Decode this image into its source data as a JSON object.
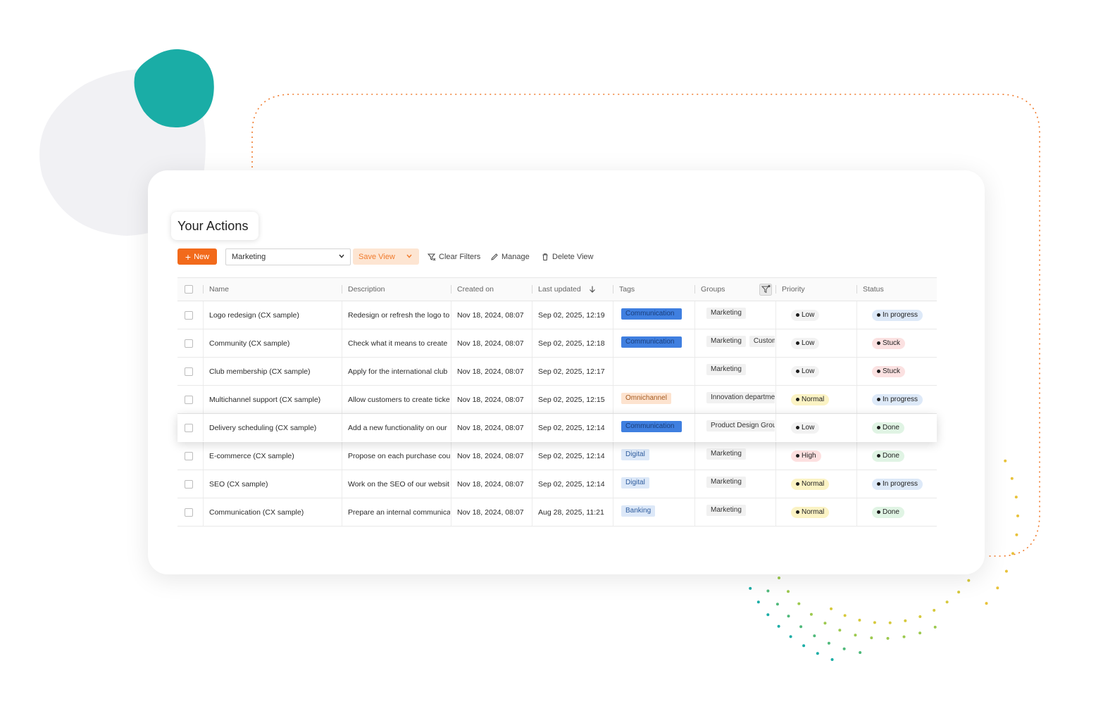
{
  "page": {
    "title": "Your Actions"
  },
  "toolbar": {
    "new_label": "New",
    "view_select": "Marketing",
    "save_view_label": "Save View",
    "clear_filters_label": "Clear Filters",
    "manage_label": "Manage",
    "delete_view_label": "Delete View"
  },
  "table": {
    "headers": {
      "name": "Name",
      "description": "Description",
      "created": "Created on",
      "updated": "Last updated",
      "tags": "Tags",
      "groups": "Groups",
      "priority": "Priority",
      "status": "Status"
    },
    "rows": [
      {
        "name": "Logo redesign (CX sample)",
        "description": "Redesign or refresh the logo to",
        "created": "Nov 18, 2024, 08:07",
        "updated": "Sep 02, 2025, 12:19",
        "tag": "Communication",
        "tag_style": "comm",
        "groups": [
          "Marketing"
        ],
        "priority": "Low",
        "status": "In progress"
      },
      {
        "name": "Community (CX sample)",
        "description": "Check what it means to create",
        "created": "Nov 18, 2024, 08:07",
        "updated": "Sep 02, 2025, 12:18",
        "tag": "Communication",
        "tag_style": "comm",
        "groups": [
          "Marketing",
          "Custom"
        ],
        "priority": "Low",
        "status": "Stuck"
      },
      {
        "name": "Club membership (CX sample)",
        "description": "Apply for the international club",
        "created": "Nov 18, 2024, 08:07",
        "updated": "Sep 02, 2025, 12:17",
        "tag": "",
        "tag_style": "none",
        "groups": [
          "Marketing"
        ],
        "priority": "Low",
        "status": "Stuck"
      },
      {
        "name": "Multichannel support (CX sample)",
        "description": "Allow customers to create ticke",
        "created": "Nov 18, 2024, 08:07",
        "updated": "Sep 02, 2025, 12:15",
        "tag": "Omnichannel",
        "tag_style": "omni",
        "groups": [
          "Innovation departme"
        ],
        "priority": "Normal",
        "status": "In progress"
      },
      {
        "name": "Delivery scheduling (CX sample)",
        "description": "Add a new functionality on our",
        "created": "Nov 18, 2024, 08:07",
        "updated": "Sep 02, 2025, 12:14",
        "tag": "Communication",
        "tag_style": "comm",
        "groups": [
          "Product Design Grou"
        ],
        "priority": "Low",
        "status": "Done"
      },
      {
        "name": "E-commerce (CX sample)",
        "description": "Propose on each purchase cou",
        "created": "Nov 18, 2024, 08:07",
        "updated": "Sep 02, 2025, 12:14",
        "tag": "Digital",
        "tag_style": "light",
        "groups": [
          "Marketing"
        ],
        "priority": "High",
        "status": "Done"
      },
      {
        "name": "SEO (CX sample)",
        "description": "Work on the SEO of our websit",
        "created": "Nov 18, 2024, 08:07",
        "updated": "Sep 02, 2025, 12:14",
        "tag": "Digital",
        "tag_style": "light",
        "groups": [
          "Marketing"
        ],
        "priority": "Normal",
        "status": "In progress"
      },
      {
        "name": "Communication (CX sample)",
        "description": "Prepare an internal communica",
        "created": "Nov 18, 2024, 08:07",
        "updated": "Aug 28, 2025, 11:21",
        "tag": "Banking",
        "tag_style": "light",
        "groups": [
          "Marketing"
        ],
        "priority": "Normal",
        "status": "Done"
      }
    ]
  },
  "colors": {
    "accent": "#f26a1b",
    "tag_communication": "#3f7fe0",
    "tag_light": "#dce8f8",
    "tag_omnichannel": "#fde3cf",
    "priority_low": "#f2f2f2",
    "priority_normal": "#fbf3c4",
    "priority_high": "#fde0e0",
    "status_in_progress": "#dde9f8",
    "status_stuck": "#fbe1e1",
    "status_done": "#e0f4e4",
    "teal": "#1bada6"
  }
}
